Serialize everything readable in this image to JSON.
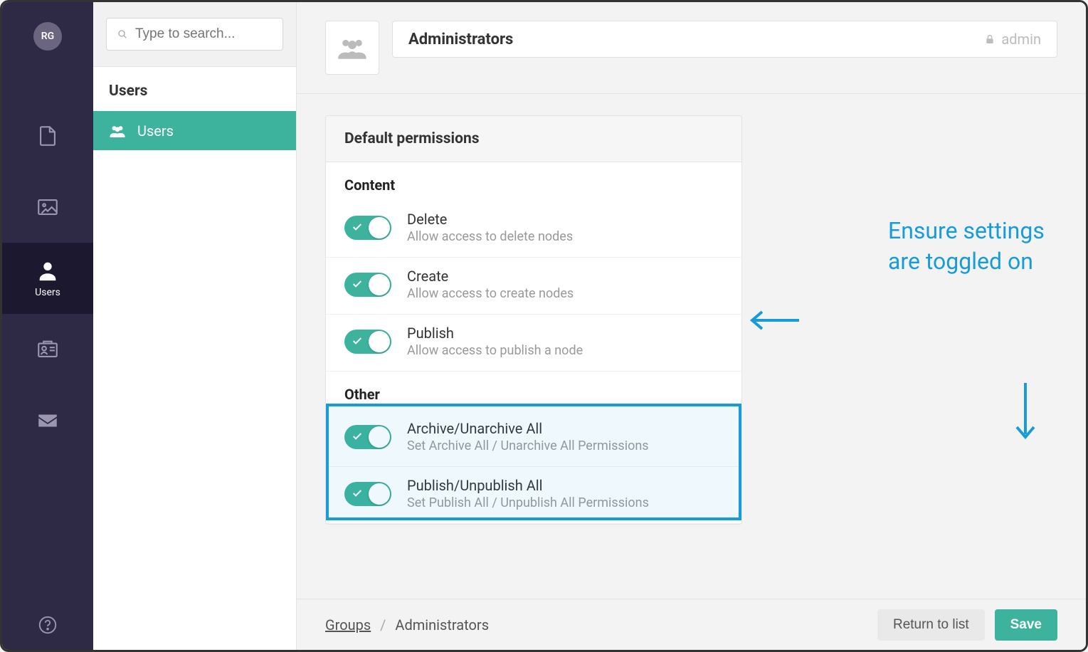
{
  "avatar_initials": "RG",
  "search": {
    "placeholder": "Type to search..."
  },
  "rail": {
    "users_label": "Users"
  },
  "list": {
    "header": "Users",
    "item_users": "Users"
  },
  "header": {
    "title": "Administrators",
    "lock_label": "admin"
  },
  "permissions": {
    "panel_title": "Default permissions",
    "section_content": "Content",
    "section_other": "Other",
    "content_items": [
      {
        "name": "Delete",
        "desc": "Allow access to delete nodes"
      },
      {
        "name": "Create",
        "desc": "Allow access to create nodes"
      },
      {
        "name": "Publish",
        "desc": "Allow access to publish a node"
      }
    ],
    "other_items": [
      {
        "name": "Archive/Unarchive All",
        "desc": "Set Archive All / Unarchive All Permissions"
      },
      {
        "name": "Publish/Unpublish All",
        "desc": "Set Publish All / Unpublish All Permissions"
      }
    ]
  },
  "breadcrumb": {
    "groups": "Groups",
    "current": "Administrators"
  },
  "footer": {
    "return": "Return to list",
    "save": "Save"
  },
  "annotation": {
    "text": "Ensure settings are toggled on"
  }
}
